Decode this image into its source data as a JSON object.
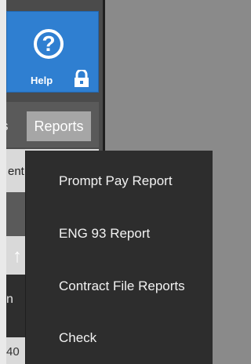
{
  "ribbon": {
    "help_label": "Help",
    "help_glyph": "?",
    "tabs": [
      {
        "label": "s"
      },
      {
        "label": "Reports"
      }
    ]
  },
  "background_fragments": {
    "ent": "ent",
    "n": "n",
    "forty": "40"
  },
  "reports_menu": {
    "items": [
      {
        "label": "Prompt Pay Report"
      },
      {
        "label": "ENG 93 Report"
      },
      {
        "label": "Contract File Reports"
      },
      {
        "label": "Check"
      }
    ]
  },
  "colors": {
    "help_panel": "#2f7fd1",
    "menu_bg": "#2d2d2d",
    "active_tab": "#a6a6a6"
  },
  "icons": [
    "question-icon",
    "lock-icon"
  ]
}
